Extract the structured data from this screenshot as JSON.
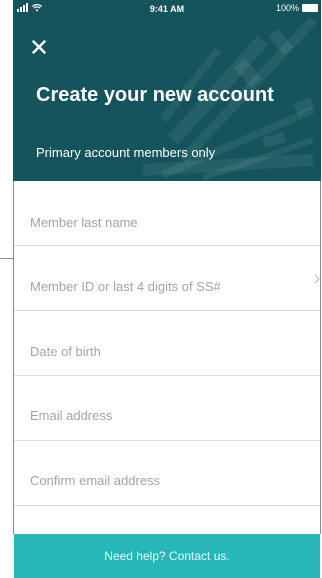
{
  "status_bar": {
    "time": "9:41 AM",
    "battery_percent": "100%"
  },
  "header": {
    "close_icon": "close-icon",
    "title": "Create your new account",
    "subtitle": "Primary account members only",
    "background_color": "#15545c"
  },
  "form": {
    "fields": [
      {
        "label": "Member last name"
      },
      {
        "label": "Member ID or last 4 digits of SS#",
        "trailing_icon": "chevron-right-icon"
      },
      {
        "label": "Date of birth"
      },
      {
        "label": "Email address"
      },
      {
        "label": "Confirm email address"
      }
    ]
  },
  "footer": {
    "help_text": "Need help? Contact us.",
    "background_color": "#26b8b8"
  }
}
